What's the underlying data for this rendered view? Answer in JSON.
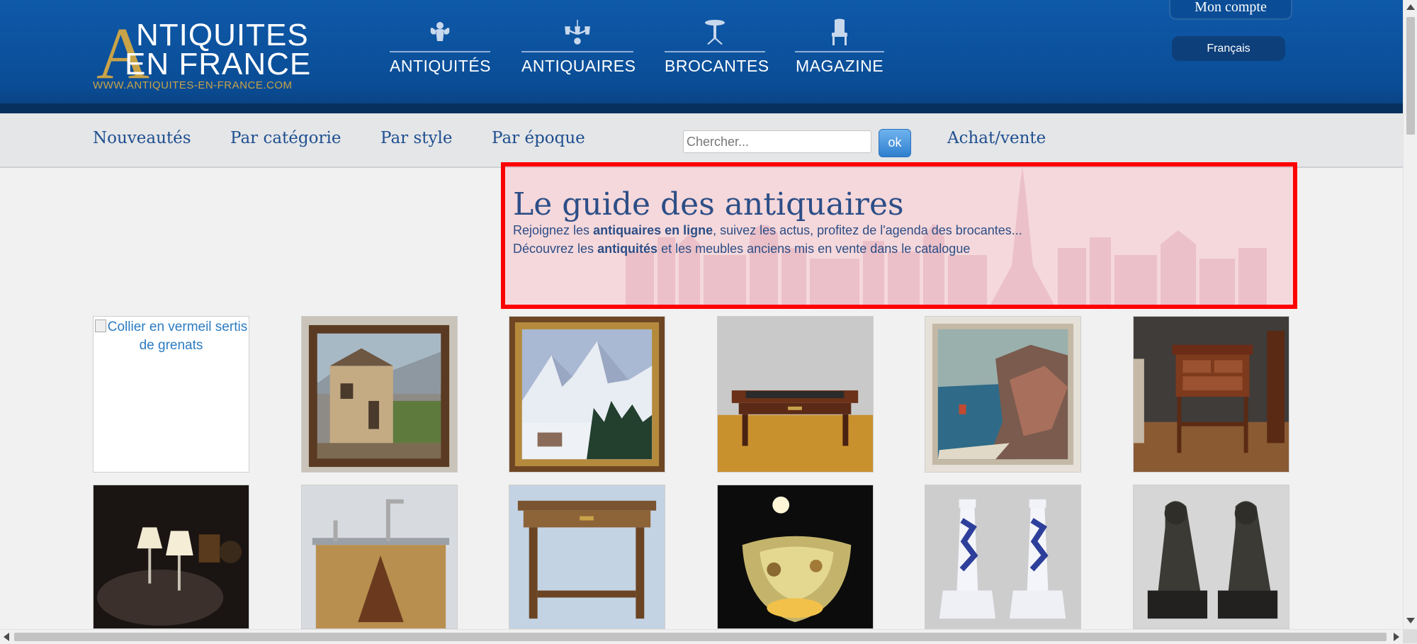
{
  "header": {
    "logo": {
      "initial": "A",
      "line1": "NTIQUITES",
      "line2": "EN FRANCE",
      "url": "WWW.ANTIQUITES-EN-FRANCE.COM"
    },
    "nav": [
      {
        "label": "ANTIQUITÉS",
        "icon": "cherub-icon"
      },
      {
        "label": "ANTIQUAIRES",
        "icon": "chandelier-icon"
      },
      {
        "label": "BROCANTES",
        "icon": "gueridon-table-icon"
      },
      {
        "label": "MAGAZINE",
        "icon": "armchair-icon"
      }
    ],
    "account_label": "Mon compte",
    "language_label": "Français"
  },
  "subnav": {
    "nouveautes": "Nouveautés",
    "categorie": "Par catégorie",
    "style": "Par style",
    "epoque": "Par époque",
    "search_placeholder": "Chercher...",
    "search_value": "",
    "ok_label": "ok",
    "achat_vente": "Achat/vente"
  },
  "hero": {
    "title": "Le guide des antiquaires",
    "line1_pre": "Rejoignez les ",
    "line1_bold": "antiquaires en ligne",
    "line1_post": ", suivez les actus, profitez de l'agenda des brocantes...",
    "line2_pre": "Découvrez les ",
    "line2_bold": "antiquités",
    "line2_post": " et les meubles anciens mis en vente dans le catalogue"
  },
  "products": {
    "row1": [
      {
        "alt": "Collier en vermeil sertis de grenats",
        "image": "broken-image"
      },
      {
        "image": "painting-mountain-village"
      },
      {
        "image": "painting-snowy-mountains"
      },
      {
        "image": "mahogany-desk"
      },
      {
        "image": "painting-seascape-cliffs"
      },
      {
        "image": "marquetry-side-table"
      }
    ],
    "row2": [
      {
        "image": "pair-of-lamps"
      },
      {
        "image": "oak-bar-cabinet"
      },
      {
        "image": "barley-twist-table"
      },
      {
        "image": "glass-ceiling-lamp"
      },
      {
        "image": "porcelain-candlesticks"
      },
      {
        "image": "bronze-dog-sculptures"
      }
    ]
  },
  "colors": {
    "header_blue": "#0b4f9a",
    "gold": "#c9a347",
    "link_blue": "#1e4f8f",
    "highlight_border": "#ff0000"
  }
}
